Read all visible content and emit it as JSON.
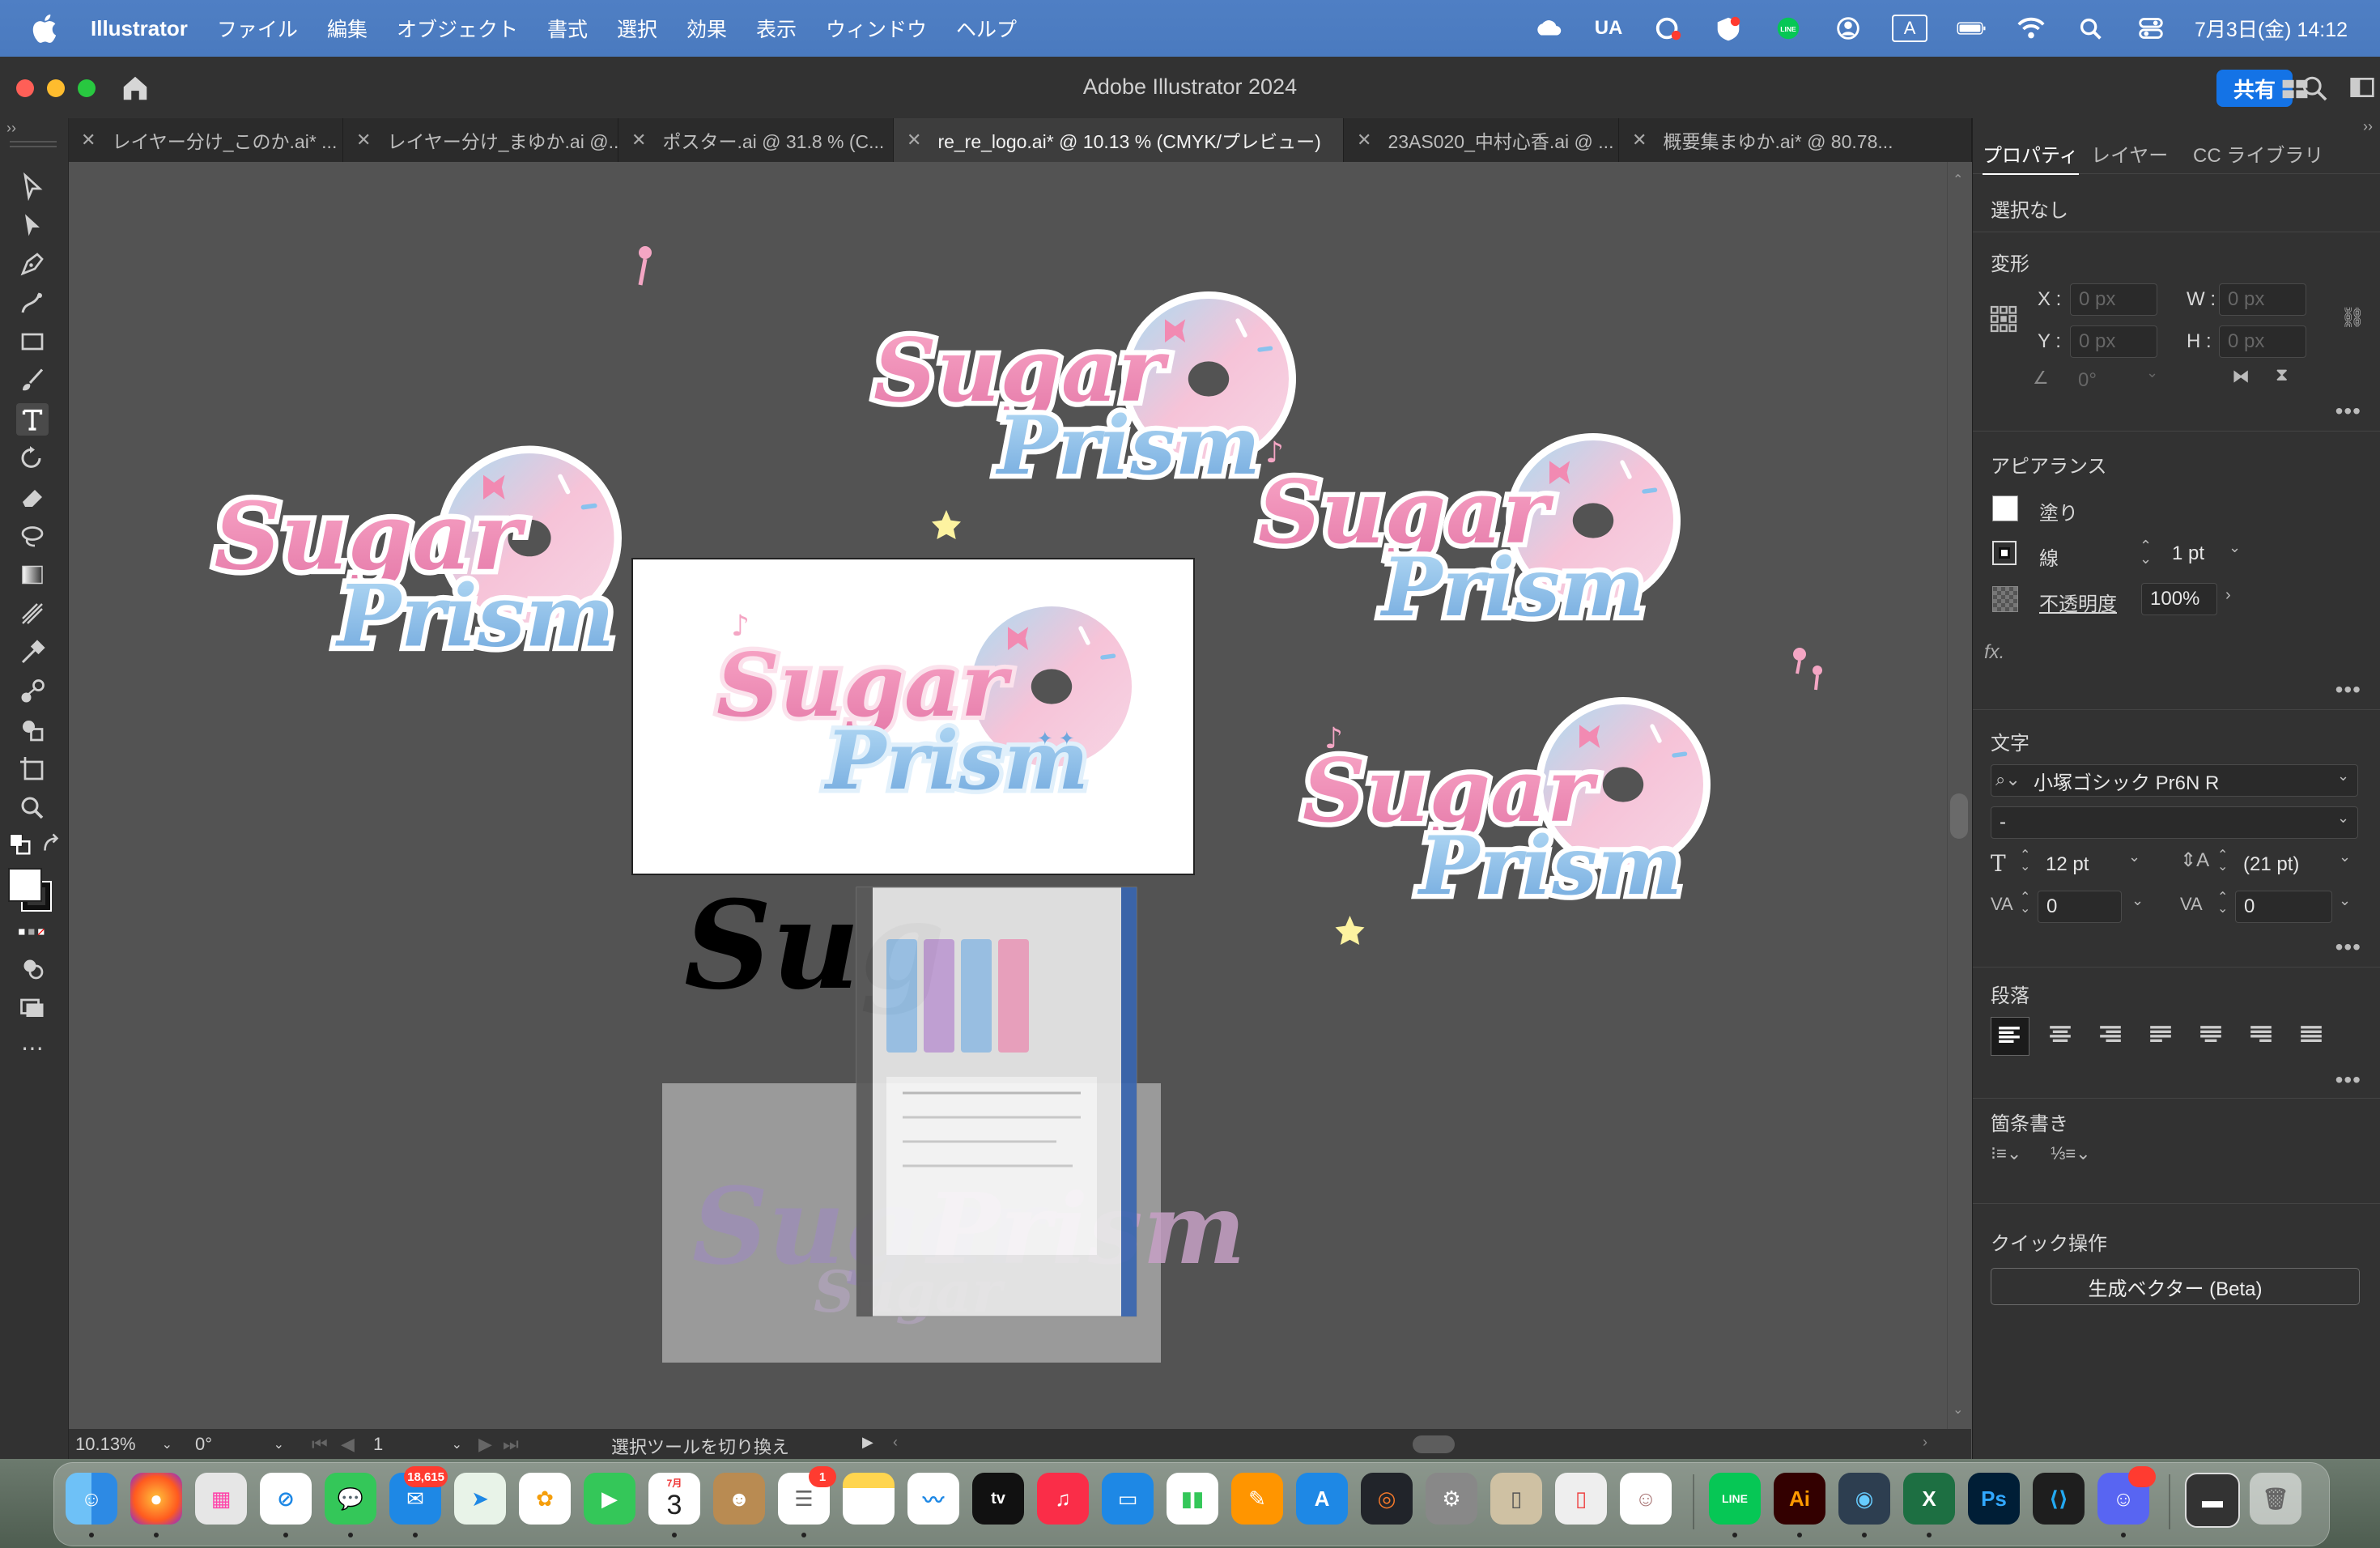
{
  "menubar": {
    "app_name": "Illustrator",
    "items": [
      "ファイル",
      "編集",
      "オブジェクト",
      "書式",
      "選択",
      "効果",
      "表示",
      "ウィンドウ",
      "ヘルプ"
    ],
    "input_mode": "UA",
    "input_source": "A",
    "datetime": "7月3日(金)  14:12"
  },
  "window": {
    "title": "Adobe Illustrator 2024",
    "share_label": "共有"
  },
  "tabs": [
    {
      "label": "レイヤー分け_このか.ai* ..."
    },
    {
      "label": "レイヤー分け_まゆか.ai @..."
    },
    {
      "label": "ポスター.ai @ 31.8 % (C..."
    },
    {
      "label": "re_re_logo.ai* @ 10.13 % (CMYK/プレビュー)"
    },
    {
      "label": "23AS020_中村心香.ai @ ..."
    },
    {
      "label": "概要集まゆか.ai* @ 80.78..."
    }
  ],
  "canvas": {
    "logo_word1": "Sugar",
    "logo_word2": "Prism",
    "black_logo_text": "Sug"
  },
  "status": {
    "zoom": "10.13%",
    "rotation": "0°",
    "artboard": "1",
    "message": "選択ツールを切り換え"
  },
  "panel": {
    "tabs": [
      "プロパティ",
      "レイヤー",
      "CC ライブラリ"
    ],
    "selection": "選択なし",
    "transform": {
      "title": "変形",
      "x_label": "X :",
      "y_label": "Y :",
      "w_label": "W :",
      "h_label": "H :",
      "x": "0 px",
      "y": "0 px",
      "w": "0 px",
      "h": "0 px",
      "angle": "0°"
    },
    "appearance": {
      "title": "アピアランス",
      "fill_label": "塗り",
      "stroke_label": "線",
      "stroke_value": "1 pt",
      "opacity_label": "不透明度",
      "opacity_value": "100%",
      "fx": "fx."
    },
    "character": {
      "title": "文字",
      "font": "小塚ゴシック Pr6N R",
      "style": "-",
      "size": "12 pt",
      "leading": "(21 pt)",
      "kerning": "0",
      "tracking": "0"
    },
    "paragraph": {
      "title": "段落"
    },
    "bullets": {
      "title": "箇条書き"
    },
    "quick_actions": {
      "title": "クイック操作",
      "button": "生成ベクター (Beta)"
    }
  },
  "dock": {
    "mail_badge": "18,615",
    "reminders_badge": "1",
    "calendar_month": "7月",
    "calendar_day": "3",
    "ai_label": "Ai",
    "ps_label": "Ps",
    "tv_label": "tv"
  }
}
